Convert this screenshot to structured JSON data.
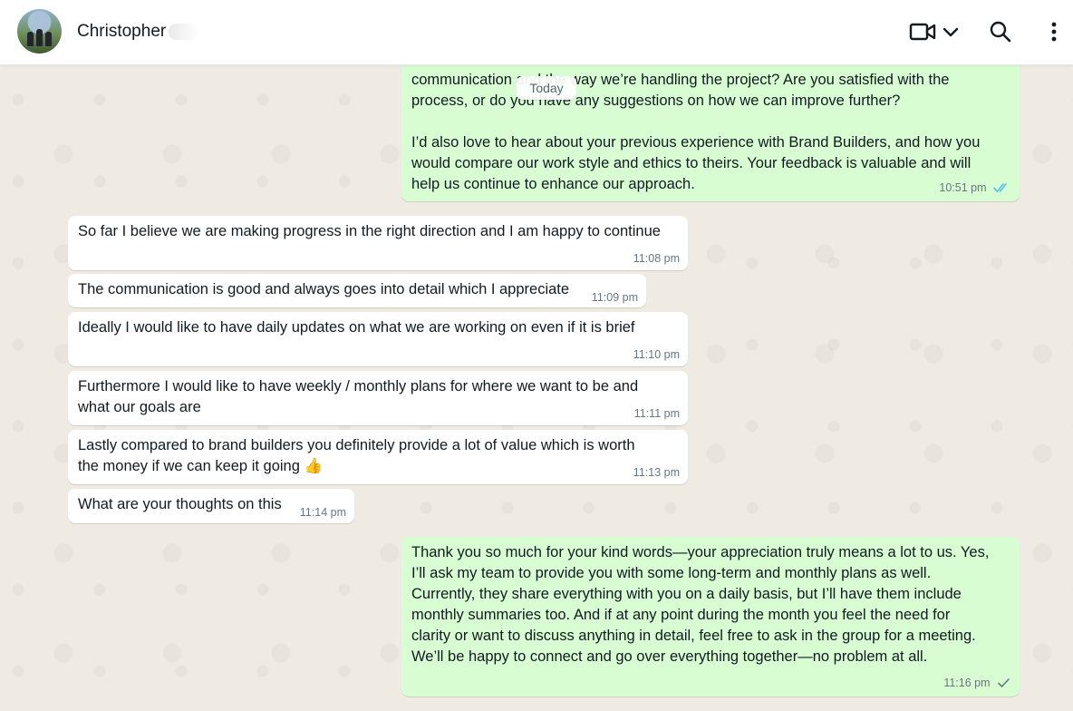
{
  "header": {
    "contact_name": "Christopher",
    "video_icon": "video-camera-icon",
    "dropdown_icon": "chevron-down-icon",
    "search_icon": "search-icon",
    "menu_icon": "vertical-dots-icon"
  },
  "date_separator": "Today",
  "messages": [
    {
      "direction": "outgoing",
      "text": "communication and the way we’re handling the project? Are you satisfied with the\nprocess, or do you have any suggestions on how we can improve further?\n\nI’d also love to hear about your previous experience with Brand Builders, and how you\nwould compare our work style and ethics to theirs. Your feedback is valuable and will\nhelp us continue to enhance our approach.",
      "time": "10:51 pm",
      "status": "read"
    },
    {
      "direction": "incoming",
      "text": "So far I believe we are making progress in the right direction and I am happy to continue",
      "time": "11:08 pm"
    },
    {
      "direction": "incoming",
      "text": "The communication is good and always goes into detail which I appreciate",
      "time": "11:09 pm"
    },
    {
      "direction": "incoming",
      "text": "Ideally I would like to have daily updates on what we are working on even if it is brief",
      "time": "11:10 pm"
    },
    {
      "direction": "incoming",
      "text": "Furthermore I would like to have weekly / monthly plans for where we want to be and\nwhat our goals are",
      "time": "11:11 pm"
    },
    {
      "direction": "incoming",
      "text": "Lastly compared to brand builders you definitely provide a lot of value which is worth\nthe money if we can keep it going 👍",
      "time": "11:13 pm"
    },
    {
      "direction": "incoming",
      "text": "What are your thoughts on this",
      "time": "11:14 pm"
    },
    {
      "direction": "outgoing",
      "text": "Thank you so much for your kind words—your appreciation truly means a lot to us. Yes,\nI’ll ask my team to provide you with some long-term and monthly plans as well.\nCurrently, they share everything with you on a daily basis, but I’ll have them include\nmonthly summaries too. And if at any point during the month you feel the need for\nclarity or want to discuss anything in detail, feel free to ask in the group for a meeting.\nWe’ll be happy to connect and go over everything together—no problem at all.",
      "time": "11:16 pm",
      "status": "sent"
    }
  ],
  "colors": {
    "incoming_bubble": "#ffffff",
    "outgoing_bubble": "#d9fdd3",
    "read_tick": "#53bdeb",
    "sent_tick": "#667781",
    "wallpaper": "#efeae2"
  }
}
